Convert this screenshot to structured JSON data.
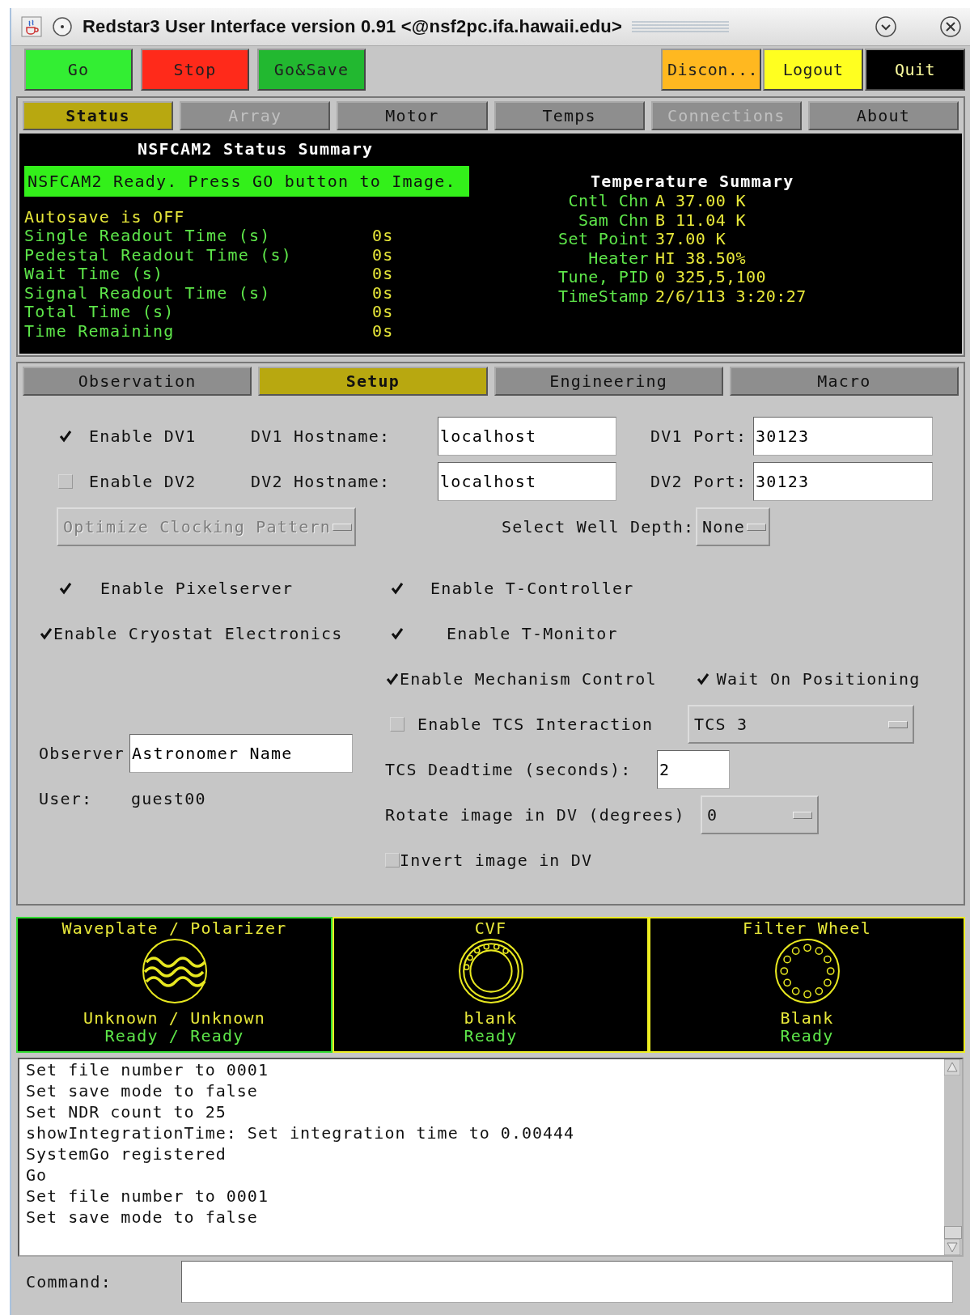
{
  "window": {
    "title": "Redstar3 User Interface version 0.91 <@nsf2pc.ifa.hawaii.edu>"
  },
  "buttons_left": [
    {
      "label": "Go",
      "color": "#33ee33"
    },
    {
      "label": "Stop",
      "color": "#ff2a1a"
    },
    {
      "label": "Go&Save",
      "color": "#22b830"
    }
  ],
  "buttons_right": [
    {
      "label": "Discon...",
      "color": "#ffb820"
    },
    {
      "label": "Logout",
      "color": "#ffff20"
    },
    {
      "label": "Quit",
      "color": "#000000"
    }
  ],
  "main_tabs": [
    {
      "label": "Status",
      "selected": true,
      "disabled": false
    },
    {
      "label": "Array",
      "selected": false,
      "disabled": true
    },
    {
      "label": "Motor",
      "selected": false,
      "disabled": false
    },
    {
      "label": "Temps",
      "selected": false,
      "disabled": false
    },
    {
      "label": "Connections",
      "selected": false,
      "disabled": true
    },
    {
      "label": "About",
      "selected": false,
      "disabled": false
    }
  ],
  "status": {
    "title": "NSFCAM2 Status Summary",
    "banner": "NSFCAM2 Ready. Press GO button to Image.",
    "autosave": "Autosave is OFF",
    "rows": [
      {
        "label": "Single Readout Time (s)",
        "value": "0s"
      },
      {
        "label": "Pedestal Readout Time (s)",
        "value": "0s"
      },
      {
        "label": "Wait Time (s)",
        "value": "0s"
      },
      {
        "label": "Signal Readout Time (s)",
        "value": "0s"
      },
      {
        "label": "Total Time (s)",
        "value": "0s"
      },
      {
        "label": "Time Remaining",
        "value": "0s"
      }
    ],
    "temperature": {
      "title": "Temperature Summary",
      "rows": [
        {
          "label": "Cntl Chn",
          "value": "A 37.00 K"
        },
        {
          "label": "Sam Chn",
          "value": "B 11.04 K"
        },
        {
          "label": "Set Point",
          "value": "37.00 K"
        },
        {
          "label": "Heater",
          "value": "HI 38.50%"
        },
        {
          "label": "Tune, PID",
          "value": "0 325,5,100"
        },
        {
          "label": "TimeStamp",
          "value": "2/6/113 3:20:27"
        }
      ]
    }
  },
  "setup_tabs": [
    {
      "label": "Observation",
      "selected": false
    },
    {
      "label": "Setup",
      "selected": true
    },
    {
      "label": "Engineering",
      "selected": false
    },
    {
      "label": "Macro",
      "selected": false
    }
  ],
  "setup": {
    "dv": [
      {
        "label": "Enable DV1",
        "checked": true,
        "host_label": "DV1 Hostname:",
        "host": "localhost",
        "port_label": "DV1 Port:",
        "port": "30123"
      },
      {
        "label": "Enable DV2",
        "checked": false,
        "host_label": "DV2 Hostname:",
        "host": "localhost",
        "port_label": "DV2 Port:",
        "port": "30123"
      }
    ],
    "optimize": {
      "label": "Optimize Clocking Pattern",
      "disabled": true
    },
    "well_depth": {
      "label": "Select Well Depth:",
      "value": "None"
    },
    "left_checks": [
      {
        "label": "Enable Pixelserver",
        "checked": true
      },
      {
        "label": "Enable Cryostat Electronics",
        "checked": true
      }
    ],
    "right_checks": [
      {
        "label": "Enable T-Controller",
        "checked": true
      },
      {
        "label": "Enable T-Monitor",
        "checked": true
      }
    ],
    "mechanism": {
      "label": "Enable Mechanism Control",
      "checked": true
    },
    "wait": {
      "label": "Wait On Positioning",
      "checked": true
    },
    "tcs": {
      "label": "Enable TCS Interaction",
      "checked": false,
      "option": "TCS 3"
    },
    "deadtime": {
      "label": "TCS Deadtime (seconds):",
      "value": "2"
    },
    "observer": {
      "label": "Observer",
      "value": "Astronomer Name"
    },
    "user": {
      "label": "User:",
      "value": "guest00"
    },
    "rotate": {
      "label": "Rotate image in DV (degrees)",
      "value": "0"
    },
    "invert": {
      "label": "Invert image in DV",
      "checked": false
    }
  },
  "mechanisms": [
    {
      "title": "Waveplate / Polarizer",
      "kind": "waveplate",
      "position": "Unknown / Unknown",
      "state": "Ready / Ready",
      "color": "#33dd33"
    },
    {
      "title": "CVF",
      "kind": "cvf",
      "position": "blank",
      "state": "Ready",
      "color": "#eeee22"
    },
    {
      "title": "Filter Wheel",
      "kind": "wheel",
      "position": "Blank",
      "state": "Ready",
      "color": "#eeee22"
    }
  ],
  "log": [
    "Set file number to 0001",
    "Set save mode to false",
    "Set NDR count to 25",
    "showIntegrationTime: Set integration time to 0.00444",
    "SystemGo registered",
    "Go",
    "Set file number to 0001",
    "Set save mode to false"
  ],
  "command": {
    "label": "Command:"
  }
}
